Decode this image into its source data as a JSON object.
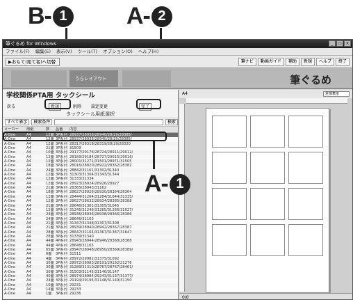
{
  "callouts": {
    "b1_letter": "B-",
    "b1_num": "1",
    "a2_letter": "A-",
    "a2_num": "2",
    "a1_letter": "A-",
    "a1_num": "1"
  },
  "window": {
    "title": "筆ぐるめ for Windows",
    "menu": [
      "ファイル(F)",
      "編集(E)",
      "表示(V)",
      "ツール(T)",
      "オプション(O)",
      "ヘルプ(H)"
    ],
    "nav_back": "▶おもて(宛て名)へ切替",
    "nav_tools": [
      "筆ナビ",
      "動画ガイド",
      "補助",
      "新規",
      "ヘルプ",
      "終了"
    ],
    "step_label": "うらレイアウト",
    "logo": "筆ぐるめ"
  },
  "left_pane": {
    "title": "学校関係PTA用 タックシール",
    "back_label": "戻る",
    "new_label": "新規",
    "delete_label": "削除",
    "settings_label": "設定変更",
    "done_label": "完了",
    "sub_title": "タックシール用紙選択",
    "filter_all": "すべて表示",
    "filter_search": "検索条件",
    "search_button": "検索",
    "columns": [
      "メーカー",
      "用紙",
      "数",
      "品番",
      "内容"
    ],
    "rows": [
      {
        "maker": "A-One",
        "size": "A4",
        "count": "12面",
        "code": "3P系列",
        "content": "28937/28938/28940/28/29/28385/"
      },
      {
        "maker": "A-One",
        "size": "A4",
        "count": "12面",
        "code": "3P系列",
        "content": "28937/28938/28940/28/29/28385/"
      },
      {
        "maker": "A-One",
        "size": "A4",
        "count": "12面",
        "code": "3P系列",
        "content": "28317/28318/28319/28/29/28320"
      },
      {
        "maker": "A-One",
        "size": "A4",
        "count": "21面",
        "code": "3P系列",
        "content": "31509"
      },
      {
        "maker": "A-One",
        "size": "A4",
        "count": "10面",
        "code": "3P系列",
        "content": "29177/29176/28724/28911/29012/"
      },
      {
        "maker": "A-One",
        "size": "A4",
        "count": "12面",
        "code": "3P系列",
        "content": "28183/29184/28727/29015/29016/"
      },
      {
        "maker": "A-One",
        "size": "A4",
        "count": "12面",
        "code": "3P系列",
        "content": "28001/31271/31501/28971/31505"
      },
      {
        "maker": "A-One",
        "size": "A4",
        "count": "18面",
        "code": "3P系列",
        "content": "28016/28820/28922/28362/28382"
      },
      {
        "maker": "A-One",
        "size": "A4",
        "count": "24面",
        "code": "3P系列",
        "content": "28842/31161/31302/31340"
      },
      {
        "maker": "A-One",
        "size": "A4",
        "count": "12面",
        "code": "3P系列",
        "content": "31303/31304/31343/31344"
      },
      {
        "maker": "A-One",
        "size": "A4",
        "count": "12面",
        "code": "3P系列",
        "content": "31333/31334"
      },
      {
        "maker": "A-One",
        "size": "A4",
        "count": "12面",
        "code": "3P系列",
        "content": "28923/28924/28926/28927"
      },
      {
        "maker": "A-One",
        "size": "A4",
        "count": "21面",
        "code": "3P系列",
        "content": "28365/28943/31162"
      },
      {
        "maker": "A-One",
        "size": "A4",
        "count": "18面",
        "code": "3P系列",
        "content": "28627/28926/28930/28364/28364"
      },
      {
        "maker": "A-One",
        "size": "A4",
        "count": "12面",
        "code": "3P系列",
        "content": "28444/31264/31284/31644/31335/"
      },
      {
        "maker": "A-One",
        "size": "A4",
        "count": "12面",
        "code": "3P系列",
        "content": "28627/28632/28934/28385/28388"
      },
      {
        "maker": "A-One",
        "size": "A4",
        "count": "21面",
        "code": "3P系列",
        "content": "28646/31301/31305/31045"
      },
      {
        "maker": "A-One",
        "size": "A4",
        "count": "12面",
        "code": "3P系列",
        "content": "31245/31246/31265/31266/31027/"
      },
      {
        "maker": "A-One",
        "size": "A4",
        "count": "24面",
        "code": "3P系列",
        "content": "28935/28936/28938/28366/28386"
      },
      {
        "maker": "A-One",
        "size": "A4",
        "count": "24面",
        "code": "3P系列",
        "content": "28646/31163"
      },
      {
        "maker": "A-One",
        "size": "A4",
        "count": "21面",
        "code": "3P系列",
        "content": "31347/31348/31307/31308"
      },
      {
        "maker": "A-One",
        "size": "A4",
        "count": "21面",
        "code": "3P系列",
        "content": "28939/28940/28942/28367/28387"
      },
      {
        "maker": "A-One",
        "size": "A4",
        "count": "28面",
        "code": "3P系列",
        "content": "28647/31164/31367/31387/31647"
      },
      {
        "maker": "A-One",
        "size": "A4",
        "count": "28面",
        "code": "3P系列",
        "content": "31339/31340"
      },
      {
        "maker": "A-One",
        "size": "A4",
        "count": "44面",
        "code": "4P系列",
        "content": "28943/28944/28946/28368/28388"
      },
      {
        "maker": "A-One",
        "size": "A4",
        "count": "44面",
        "code": "4P系列",
        "content": "28648/31165"
      },
      {
        "maker": "A-One",
        "size": "A4",
        "count": "65面",
        "code": "3P系列",
        "content": "28947/28948/28950/28369/28389/"
      },
      {
        "maker": "A-One",
        "size": "A4",
        "count": "6面",
        "code": "3P系列",
        "content": "31511"
      },
      {
        "maker": "A-One",
        "size": "A4",
        "count": "4面",
        "code": "3P系列",
        "content": "28972/29982/31375/31092"
      },
      {
        "maker": "A-One",
        "size": "A4",
        "count": "30面",
        "code": "3P系列",
        "content": "28972/28983/28191/29192/21276"
      },
      {
        "maker": "A-One",
        "size": "A4",
        "count": "30面",
        "code": "3P系列",
        "content": "31289/31310/28767/28767/28461/"
      },
      {
        "maker": "A-One",
        "size": "A4",
        "count": "30面",
        "code": "3P系列",
        "content": "31503/31145/31146/31147"
      },
      {
        "maker": "A-One",
        "size": "A4",
        "count": "40面",
        "code": "3P系列",
        "content": "28974/28984/29243/31137/31377/"
      },
      {
        "maker": "A-One",
        "size": "A4",
        "count": "24面",
        "code": "3P系列",
        "content": "29194/29195/31148/31149/31150"
      },
      {
        "maker": "A-One",
        "size": "A4",
        "count": "10面",
        "code": "3P系列",
        "content": "29231"
      },
      {
        "maker": "A-One",
        "size": "A4",
        "count": "14面",
        "code": "3P系列",
        "content": "29233"
      },
      {
        "maker": "A-One",
        "size": "A4",
        "count": "1面",
        "code": "3P系列",
        "content": "29236"
      }
    ]
  },
  "right_pane": {
    "header": "A4",
    "zoom": "全体表示",
    "status": "0/0"
  }
}
